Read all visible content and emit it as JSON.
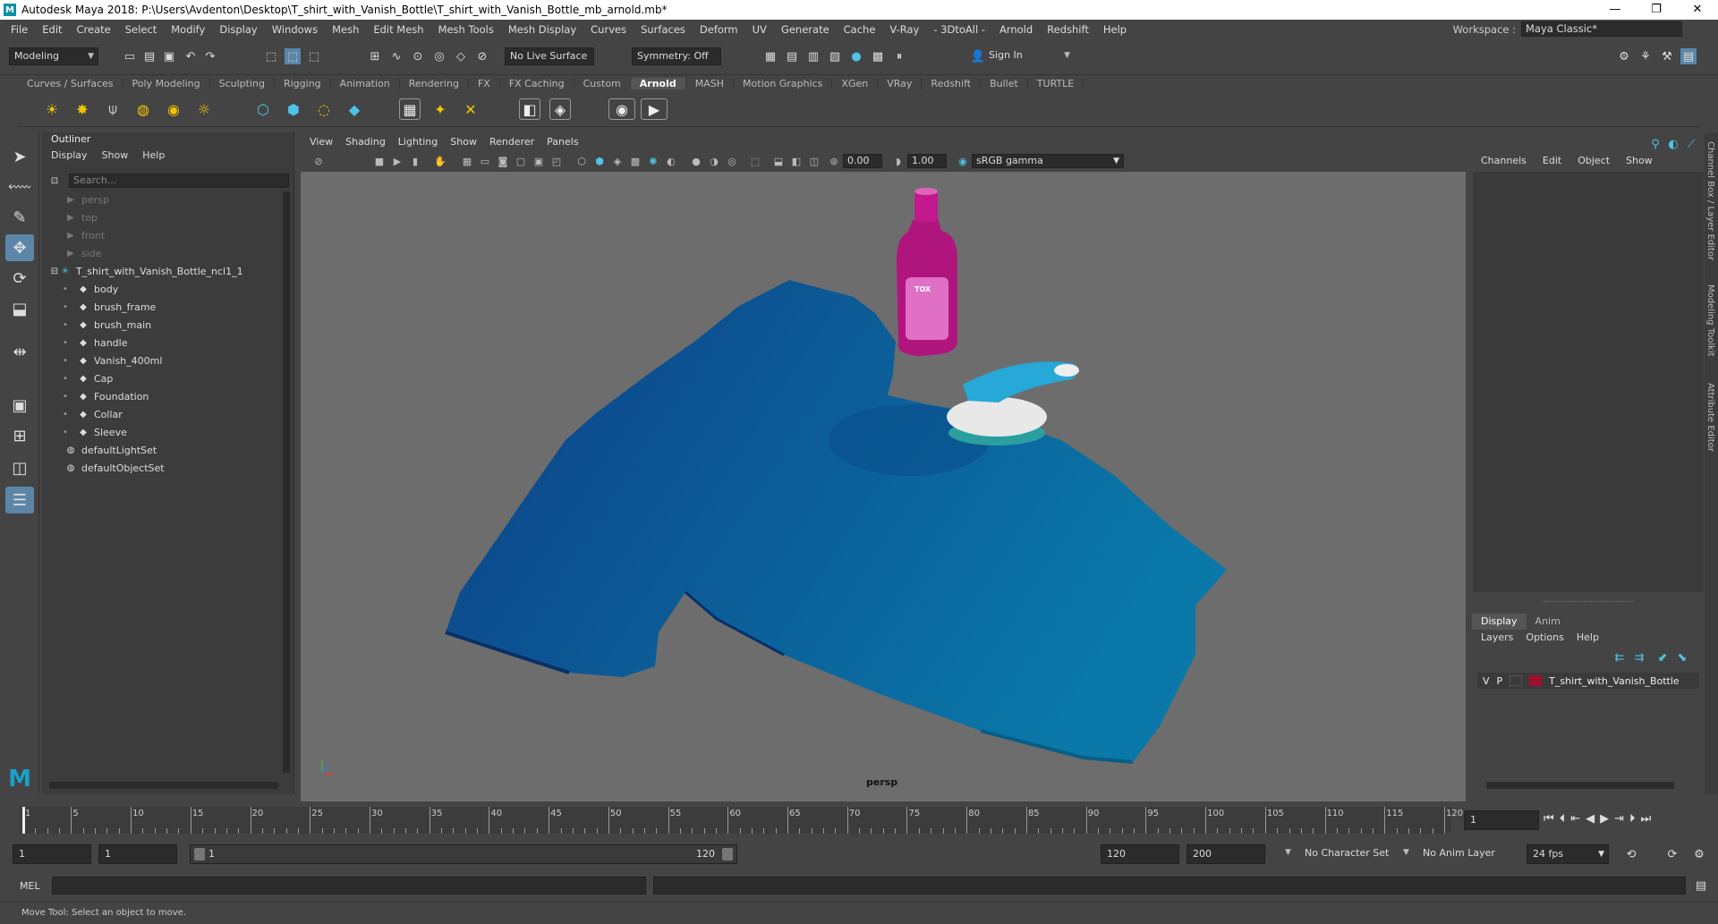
{
  "window": {
    "title": "Autodesk Maya 2018: P:\\Users\\Avdenton\\Desktop\\T_shirt_with_Vanish_Bottle\\T_shirt_with_Vanish_Bottle_mb_arnold.mb*",
    "logo": "M",
    "minimize": "—",
    "maximize": "❐",
    "close": "✕"
  },
  "menubar": {
    "items": [
      "File",
      "Edit",
      "Create",
      "Select",
      "Modify",
      "Display",
      "Windows",
      "Mesh",
      "Edit Mesh",
      "Mesh Tools",
      "Mesh Display",
      "Curves",
      "Surfaces",
      "Deform",
      "UV",
      "Generate",
      "Cache",
      "V-Ray",
      "- 3DtoAll -",
      "Arnold",
      "Redshift",
      "Help"
    ],
    "workspace_label": "Workspace :",
    "workspace_value": "Maya Classic*"
  },
  "statusline": {
    "mode": "Modeling",
    "live_surface": "No Live Surface",
    "symmetry": "Symmetry: Off",
    "sign_in": "Sign In"
  },
  "shelf": {
    "tabs": [
      "Curves / Surfaces",
      "Poly Modeling",
      "Sculpting",
      "Rigging",
      "Animation",
      "Rendering",
      "FX",
      "FX Caching",
      "Custom",
      "Arnold",
      "MASH",
      "Motion Graphics",
      "XGen",
      "VRay",
      "Redshift",
      "Bullet",
      "TURTLE"
    ],
    "active_tab": "Arnold"
  },
  "outliner": {
    "title": "Outliner",
    "menu": [
      "Display",
      "Show",
      "Help"
    ],
    "search_placeholder": "Search...",
    "items": [
      {
        "label": "persp",
        "icon": "camera-icon",
        "level": 1,
        "dim": true
      },
      {
        "label": "top",
        "icon": "camera-icon",
        "level": 1,
        "dim": true
      },
      {
        "label": "front",
        "icon": "camera-icon",
        "level": 1,
        "dim": true
      },
      {
        "label": "side",
        "icon": "camera-icon",
        "level": 1,
        "dim": true
      },
      {
        "label": "T_shirt_with_Vanish_Bottle_ncl1_1",
        "icon": "group-icon",
        "level": 0,
        "dim": false
      },
      {
        "label": "body",
        "icon": "mesh-icon",
        "level": 2,
        "dim": false
      },
      {
        "label": "brush_frame",
        "icon": "mesh-icon",
        "level": 2,
        "dim": false
      },
      {
        "label": "brush_main",
        "icon": "mesh-icon",
        "level": 2,
        "dim": false
      },
      {
        "label": "handle",
        "icon": "mesh-icon",
        "level": 2,
        "dim": false
      },
      {
        "label": "Vanish_400ml",
        "icon": "mesh-icon",
        "level": 2,
        "dim": false
      },
      {
        "label": "Cap",
        "icon": "mesh-icon",
        "level": 2,
        "dim": false
      },
      {
        "label": "Foundation",
        "icon": "mesh-icon",
        "level": 2,
        "dim": false
      },
      {
        "label": "Collar",
        "icon": "mesh-icon",
        "level": 2,
        "dim": false
      },
      {
        "label": "Sleeve",
        "icon": "mesh-icon",
        "level": 2,
        "dim": false
      },
      {
        "label": "defaultLightSet",
        "icon": "set-icon",
        "level": 1,
        "dim": false
      },
      {
        "label": "defaultObjectSet",
        "icon": "set-icon",
        "level": 1,
        "dim": false
      }
    ]
  },
  "viewport": {
    "menu": [
      "View",
      "Shading",
      "Lighting",
      "Show",
      "Renderer",
      "Panels"
    ],
    "exposure": "0.00",
    "gamma": "1.00",
    "color_space": "sRGB gamma",
    "camera_label": "persp",
    "colors": {
      "shirt_dark": "#0d3f86",
      "shirt_light": "#0a78a8",
      "bottle": "#b0157e",
      "brush_handle": "#26a8d8"
    },
    "bottle_text": "TOX"
  },
  "channelbox": {
    "tabs": [
      "Channels",
      "Edit",
      "Object",
      "Show"
    ],
    "layer_tabs": [
      "Display",
      "Anim"
    ],
    "active_layer_tab": "Display",
    "layer_menu": [
      "Layers",
      "Options",
      "Help"
    ],
    "layer": {
      "v": "V",
      "p": "P",
      "name": "T_shirt_with_Vanish_Bottle",
      "color": "#a0102c"
    }
  },
  "sidetabs": [
    "Channel Box / Layer Editor",
    "Modeling Toolkit",
    "Attribute Editor"
  ],
  "timeline": {
    "ticks": [
      "1",
      "5",
      "10",
      "15",
      "20",
      "25",
      "30",
      "35",
      "40",
      "45",
      "50",
      "55",
      "60",
      "65",
      "70",
      "75",
      "80",
      "85",
      "90",
      "95",
      "100",
      "105",
      "110",
      "115",
      "120"
    ],
    "current_frame": "1",
    "current_frame_value": 1
  },
  "range": {
    "start": "1",
    "playback_start": "1",
    "slider_start": "1",
    "slider_end": "120",
    "playback_end": "120",
    "end": "200",
    "character_set": "No Character Set",
    "anim_layer": "No Anim Layer",
    "fps": "24 fps"
  },
  "mel": {
    "label": "MEL"
  },
  "helpline": {
    "text": "Move Tool: Select an object to move."
  }
}
